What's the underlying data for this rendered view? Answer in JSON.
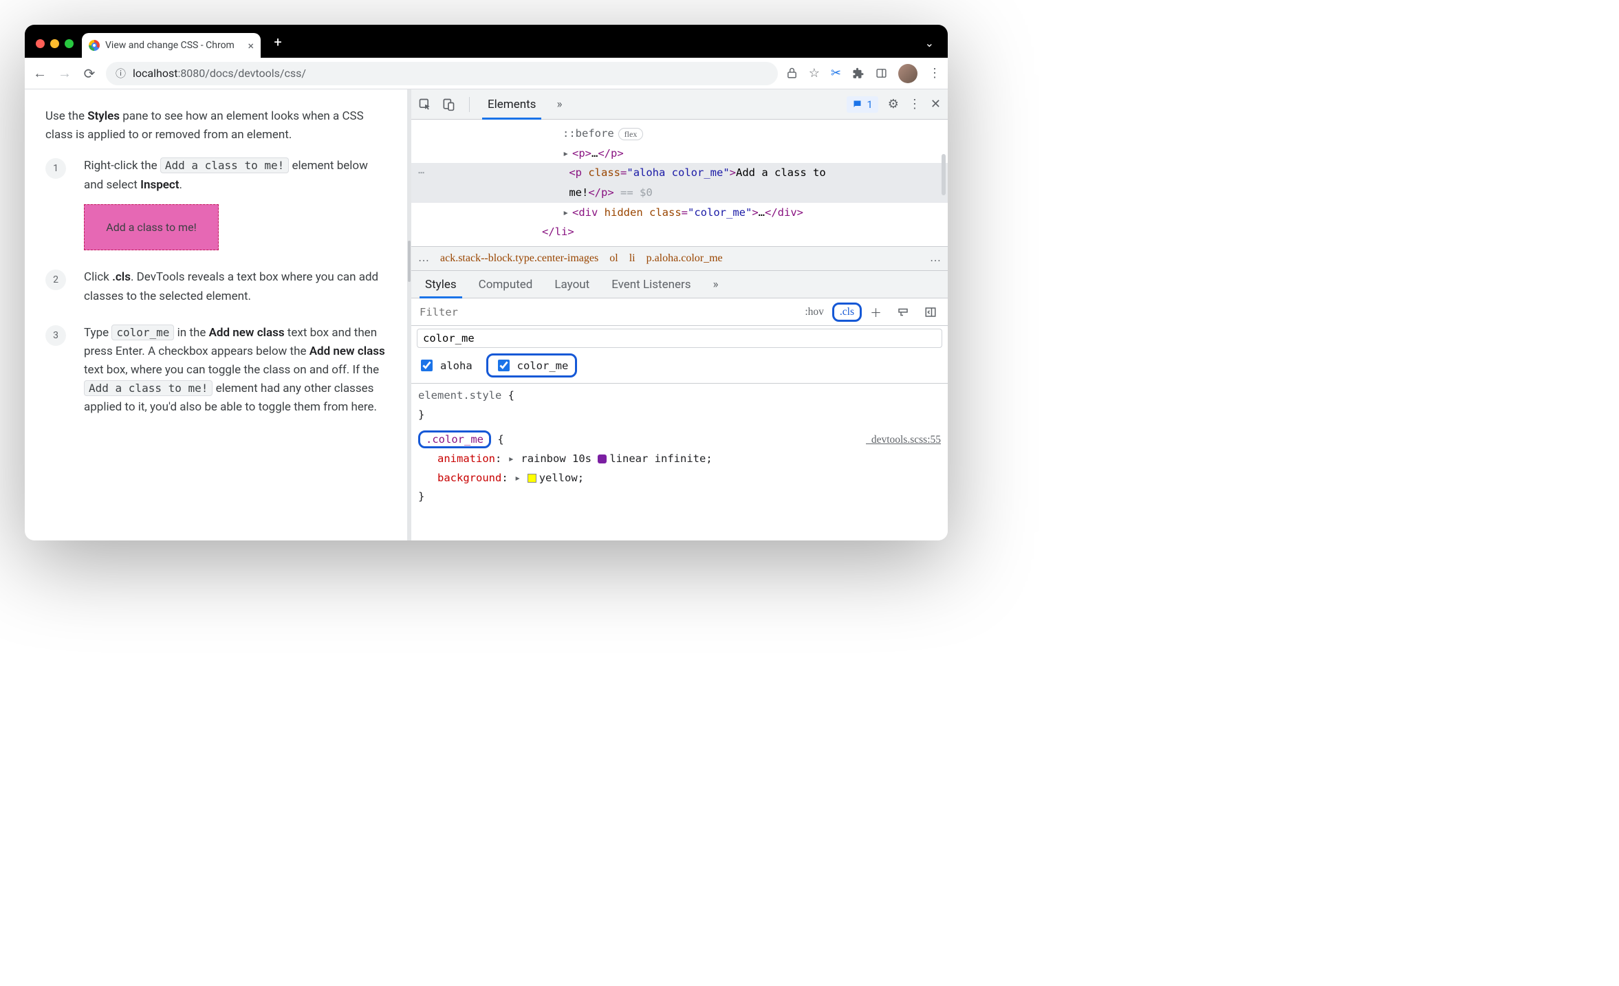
{
  "browser": {
    "tab_title": "View and change CSS - Chrom",
    "url_display_prefix": "localhost",
    "url_display_port": ":8080",
    "url_display_path": "/docs/devtools/css/"
  },
  "page": {
    "intro_prefix": "Use the ",
    "intro_bold": "Styles",
    "intro_suffix": " pane to see how an element looks when a CSS class is applied to or removed from an element.",
    "steps": {
      "s1_a": "Right-click the ",
      "s1_code": "Add a class to me!",
      "s1_b": " element below and select ",
      "s1_bold": "Inspect",
      "s1_c": ".",
      "demo_box": "Add a class to me!",
      "s2_a": "Click ",
      "s2_bold": ".cls",
      "s2_b": ". DevTools reveals a text box where you can add classes to the selected element.",
      "s3_a": "Type ",
      "s3_code1": "color_me",
      "s3_b": " in the ",
      "s3_bold1": "Add new class",
      "s3_c": " text box and then press Enter. A checkbox appears below the ",
      "s3_bold2": "Add new class",
      "s3_d": " text box, where you can toggle the class on and off. If the ",
      "s3_code2": "Add a class to me!",
      "s3_e": " element had any other classes applied to it, you'd also be able to toggle them from here."
    }
  },
  "devtools": {
    "tabs": {
      "elements": "Elements"
    },
    "issues_count": "1",
    "dom": {
      "pseudo_before": "::before",
      "flex_badge": "flex",
      "p_collapsed_open": "<p>",
      "p_collapsed_ell": "…",
      "p_collapsed_close": "</p>",
      "sel_line1": "<p class=\"aloha color_me\">Add a class to",
      "sel_line2_text": "me!",
      "sel_line2_close": "</p>",
      "sel_line2_meta": " == $0",
      "div_line": "<div hidden class=\"color_me\">…</div>",
      "li_close": "</li>"
    },
    "crumbs": {
      "c1": "ack.stack--block.type.center-images",
      "c2": "ol",
      "c3": "li",
      "c4": "p.aloha.color_me"
    },
    "subtabs": {
      "styles": "Styles",
      "computed": "Computed",
      "layout": "Layout",
      "listeners": "Event Listeners"
    },
    "styles": {
      "filter_placeholder": "Filter",
      "hov": ":hov",
      "cls": ".cls",
      "class_input_value": "color_me",
      "check1": "aloha",
      "check2": "color_me",
      "rule_element": "element.style",
      "rule_color_me_selector": ".color_me",
      "rule_color_me_source": "_devtools.scss:55",
      "anim_prop": "animation",
      "anim_val_a": "rainbow 10s ",
      "anim_val_b": "linear infinite",
      "bg_prop": "background",
      "bg_val": "yellow"
    }
  }
}
